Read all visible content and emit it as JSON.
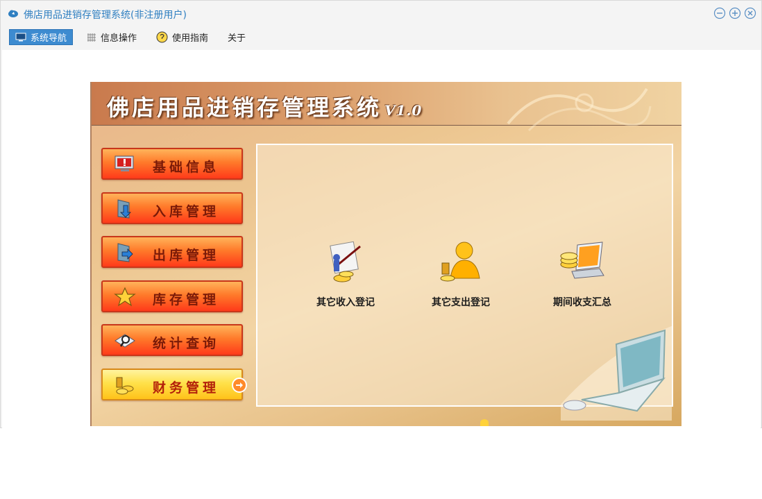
{
  "window": {
    "title": "佛店用品进销存管理系统(非注册用户)"
  },
  "menubar": {
    "items": [
      {
        "label": "系统导航",
        "active": true
      },
      {
        "label": "信息操作",
        "active": false
      },
      {
        "label": "使用指南",
        "active": false
      },
      {
        "label": "关于",
        "active": false
      }
    ]
  },
  "banner": {
    "title": "佛店用品进销存管理系统",
    "version": "V1.0"
  },
  "sidebar": {
    "items": [
      {
        "label": "基础信息",
        "icon": "monitor-alert-icon",
        "active": false
      },
      {
        "label": "入库管理",
        "icon": "inbound-door-icon",
        "active": false
      },
      {
        "label": "出库管理",
        "icon": "outbound-door-icon",
        "active": false
      },
      {
        "label": "库存管理",
        "icon": "star-icon",
        "active": false
      },
      {
        "label": "统计查询",
        "icon": "magnifier-icon",
        "active": false
      },
      {
        "label": "财务管理",
        "icon": "gold-coins-icon",
        "active": true
      }
    ]
  },
  "panel": {
    "functions": [
      {
        "label": "其它收入登记",
        "icon": "income-record-icon"
      },
      {
        "label": "其它支出登记",
        "icon": "expense-record-icon"
      },
      {
        "label": "期间收支汇总",
        "icon": "period-summary-icon"
      }
    ]
  },
  "colors": {
    "accent": "#3d8bd0",
    "title_text": "#2f7fc1",
    "button_red": "#ff3a1a",
    "button_active_yellow": "#ffe14a"
  }
}
